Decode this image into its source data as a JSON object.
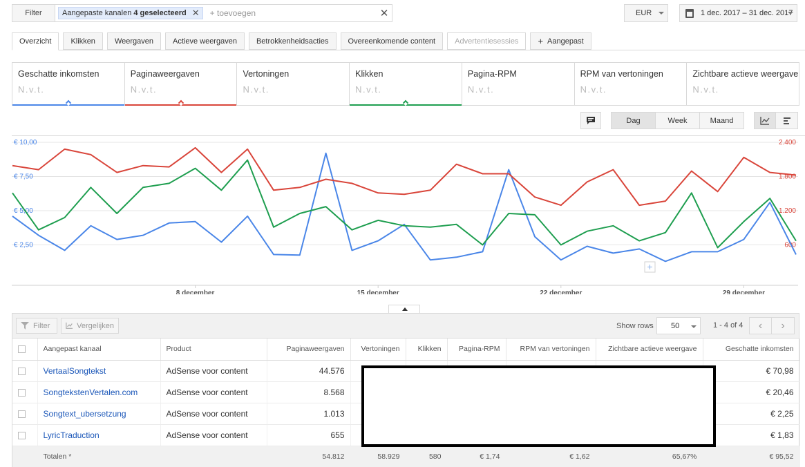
{
  "filter": {
    "label": "Filter",
    "chip_text": "Aangepaste kanalen",
    "chip_count": "4 geselecteerd",
    "add_placeholder": "+ toevoegen"
  },
  "currency": "EUR",
  "date_range": "1 dec. 2017 – 31 dec. 2017",
  "tabs": [
    {
      "label": "Overzicht",
      "active": true
    },
    {
      "label": "Klikken"
    },
    {
      "label": "Weergaven"
    },
    {
      "label": "Actieve weergaven"
    },
    {
      "label": "Betrokkenheidsacties"
    },
    {
      "label": "Overeenkomende content"
    },
    {
      "label": "Advertentiesessies",
      "disabled": true
    },
    {
      "label": "Aangepast"
    }
  ],
  "metrics": [
    {
      "name": "Geschatte inkomsten",
      "value": "N.v.t.",
      "color": "#4a86e8"
    },
    {
      "name": "Paginaweergaven",
      "value": "N.v.t.",
      "color": "#d9453a"
    },
    {
      "name": "Vertoningen",
      "value": "N.v.t."
    },
    {
      "name": "Klikken",
      "value": "N.v.t.",
      "color": "#1e9e4f"
    },
    {
      "name": "Pagina-RPM",
      "value": "N.v.t."
    },
    {
      "name": "RPM van vertoningen",
      "value": "N.v.t."
    },
    {
      "name": "Zichtbare actieve weergave",
      "value": "N.v.t."
    }
  ],
  "granularity": {
    "day": "Dag",
    "week": "Week",
    "month": "Maand",
    "selected": "Dag"
  },
  "chart_data": {
    "type": "line",
    "x": [
      "1 dec",
      "2 dec",
      "3 dec",
      "4 dec",
      "5 dec",
      "6 dec",
      "7 dec",
      "8 dec",
      "9 dec",
      "10 dec",
      "11 dec",
      "12 dec",
      "13 dec",
      "14 dec",
      "15 dec",
      "16 dec",
      "17 dec",
      "18 dec",
      "19 dec",
      "20 dec",
      "21 dec",
      "22 dec",
      "23 dec",
      "24 dec",
      "25 dec",
      "26 dec",
      "27 dec",
      "28 dec",
      "29 dec",
      "30 dec",
      "31 dec"
    ],
    "x_tick_labels": [
      "8 december",
      "15 december",
      "22 december",
      "29 december"
    ],
    "left_axis": {
      "ticks": [
        "€ 10,00",
        "€ 7,50",
        "€ 5,00",
        "€ 2,50"
      ],
      "values": [
        10,
        7.5,
        5,
        2.5
      ],
      "ylim": [
        0,
        10
      ]
    },
    "right_axis": {
      "ticks": [
        "2.400",
        "1.800",
        "1.200",
        "600"
      ],
      "values": [
        2400,
        1800,
        1200,
        600
      ],
      "ylim": [
        0,
        2400
      ]
    },
    "series": [
      {
        "name": "Geschatte inkomsten",
        "axis": "left",
        "color": "#4a86e8",
        "values": [
          4.6,
          3.2,
          2.1,
          3.9,
          2.9,
          3.2,
          4.1,
          4.2,
          2.7,
          4.6,
          1.8,
          1.75,
          9.2,
          2.1,
          2.8,
          4.0,
          1.4,
          1.6,
          2.0,
          8.0,
          3.1,
          1.4,
          2.4,
          1.9,
          2.2,
          1.3,
          2.0,
          2.0,
          2.9,
          5.6,
          1.8
        ]
      },
      {
        "name": "Paginaweergaven",
        "axis": "left",
        "color": "#d9453a",
        "values": [
          8.3,
          8.0,
          9.5,
          9.1,
          7.8,
          8.3,
          8.2,
          9.6,
          7.8,
          9.5,
          6.5,
          6.7,
          7.3,
          7.0,
          6.3,
          6.2,
          6.5,
          8.4,
          7.7,
          7.7,
          6.0,
          5.4,
          7.1,
          8.0,
          5.4,
          5.7,
          7.9,
          6.4,
          8.9,
          7.8,
          7.6
        ]
      },
      {
        "name": "Klikken",
        "axis": "left",
        "color": "#1e9e4f",
        "values": [
          6.3,
          3.6,
          4.5,
          6.7,
          4.8,
          6.7,
          7.0,
          8.1,
          6.5,
          8.7,
          3.8,
          4.8,
          5.3,
          3.6,
          4.3,
          3.9,
          3.8,
          4.0,
          2.5,
          4.8,
          4.7,
          2.5,
          3.5,
          3.9,
          2.8,
          3.4,
          6.3,
          2.3,
          4.2,
          5.9,
          2.8
        ]
      }
    ]
  },
  "table": {
    "toolbar": {
      "filter": "Filter",
      "compare": "Vergelijken",
      "show_rows": "Show rows",
      "rows_value": "50",
      "page_info": "1 - 4 of 4"
    },
    "headers": [
      "Aangepast kanaal",
      "Product",
      "Paginaweergaven",
      "Vertoningen",
      "Klikken",
      "Pagina-RPM",
      "RPM van vertoningen",
      "Zichtbare actieve weergave",
      "Geschatte inkomsten"
    ],
    "rows": [
      {
        "channel": "VertaalSongtekst",
        "product": "AdSense voor content",
        "pageviews": "44.576",
        "revenue": "€ 70,98"
      },
      {
        "channel": "SongtekstenVertalen.com",
        "product": "AdSense voor content",
        "pageviews": "8.568",
        "revenue": "€ 20,46"
      },
      {
        "channel": "Songtext_ubersetzung",
        "product": "AdSense voor content",
        "pageviews": "1.013",
        "revenue": "€ 2,25"
      },
      {
        "channel": "LyricTraduction",
        "product": "AdSense voor content",
        "pageviews": "655",
        "revenue": "€ 1,83"
      }
    ],
    "totals": {
      "label": "Totalen *",
      "pageviews": "54.812",
      "impressions": "58.929",
      "clicks": "580",
      "page_rpm": "€ 1,74",
      "imp_rpm": "€ 1,62",
      "viewability": "65,67%",
      "revenue": "€ 95,52"
    }
  }
}
